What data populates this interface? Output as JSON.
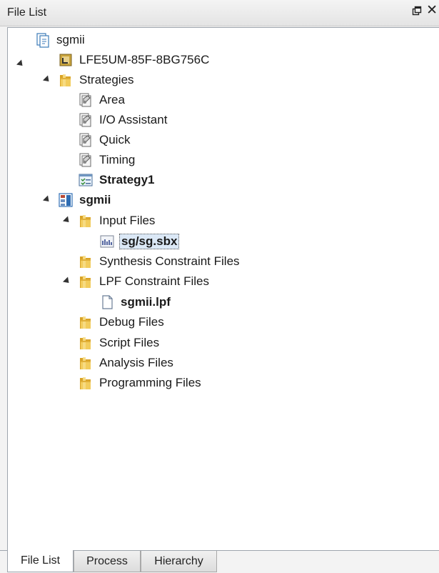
{
  "panel": {
    "title": "File List",
    "pin_icon": "pin-icon",
    "close_symbol": "✕"
  },
  "tree": {
    "project": {
      "label": "sgmii",
      "icon": "project-icon",
      "expanded": true
    },
    "device": {
      "label": "LFE5UM-85F-8BG756C",
      "icon": "chip-icon"
    },
    "strategies": {
      "label": "Strategies",
      "icon": "folder-icon",
      "expanded": true,
      "items": [
        {
          "label": "Area",
          "icon": "strategy-icon"
        },
        {
          "label": "I/O Assistant",
          "icon": "strategy-icon"
        },
        {
          "label": "Quick",
          "icon": "strategy-icon"
        },
        {
          "label": "Timing",
          "icon": "strategy-icon"
        },
        {
          "label": "Strategy1",
          "icon": "active-strategy-icon",
          "active": true
        }
      ]
    },
    "implementation": {
      "label": "sgmii",
      "icon": "implementation-icon",
      "expanded": true,
      "folders": [
        {
          "label": "Input Files",
          "expanded": true,
          "files": [
            {
              "label": "sg/sg.sbx",
              "icon": "sbx-file-icon",
              "selected": true
            }
          ]
        },
        {
          "label": "Synthesis Constraint Files",
          "expanded": false
        },
        {
          "label": "LPF Constraint Files",
          "expanded": true,
          "files": [
            {
              "label": "sgmii.lpf",
              "icon": "document-icon"
            }
          ]
        },
        {
          "label": "Debug Files",
          "expanded": false
        },
        {
          "label": "Script Files",
          "expanded": false
        },
        {
          "label": "Analysis Files",
          "expanded": false
        },
        {
          "label": "Programming Files",
          "expanded": false
        }
      ]
    }
  },
  "tabs": [
    {
      "label": "File List",
      "active": true
    },
    {
      "label": "Process",
      "active": false
    },
    {
      "label": "Hierarchy",
      "active": false
    }
  ],
  "colors": {
    "folder": "#e9b93a",
    "selection": "#dbe8f6",
    "border": "#9ea5ad"
  }
}
